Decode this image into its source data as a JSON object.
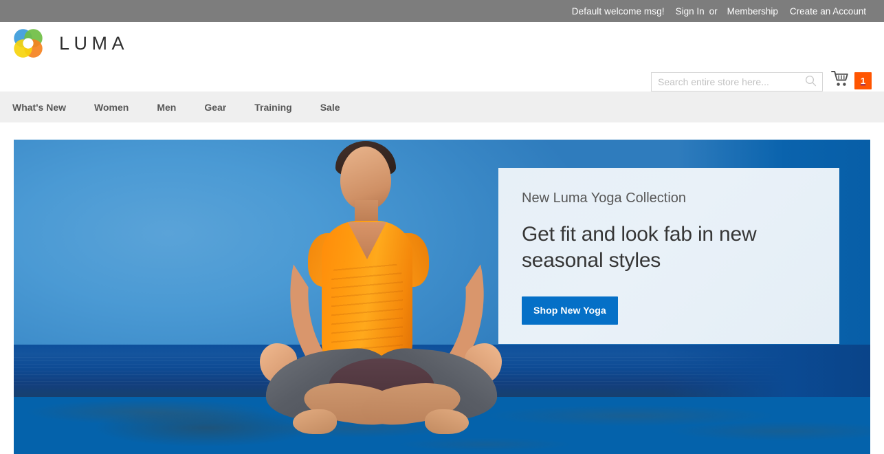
{
  "topbar": {
    "welcome": "Default welcome msg!",
    "sign_in": "Sign In",
    "separator": "or",
    "membership": "Membership",
    "create_account": "Create an Account"
  },
  "header": {
    "logo_text": "LUMA",
    "logo_icon": "luma-flower-logo",
    "search": {
      "placeholder": "Search entire store here...",
      "value": "",
      "icon": "search-icon"
    },
    "cart": {
      "icon": "shopping-cart-icon",
      "count": "1",
      "badge_color": "#ff5501"
    }
  },
  "nav": {
    "items": [
      {
        "label": "What's New"
      },
      {
        "label": "Women"
      },
      {
        "label": "Men"
      },
      {
        "label": "Gear"
      },
      {
        "label": "Training"
      },
      {
        "label": "Sale"
      }
    ]
  },
  "hero": {
    "image_alt": "Woman meditating in lotus pose on a beach wearing an orange top",
    "promo": {
      "eyebrow": "New Luma Yoga Collection",
      "title": "Get fit and look fab in new seasonal styles",
      "button_label": "Shop New Yoga",
      "button_color": "#0570c7",
      "card_background": "#e7f0f7"
    }
  },
  "colors": {
    "topbar_background": "#7d7d7d",
    "nav_background": "#efefef",
    "text_dark": "#575757",
    "banner_blue": "#0462ab"
  }
}
